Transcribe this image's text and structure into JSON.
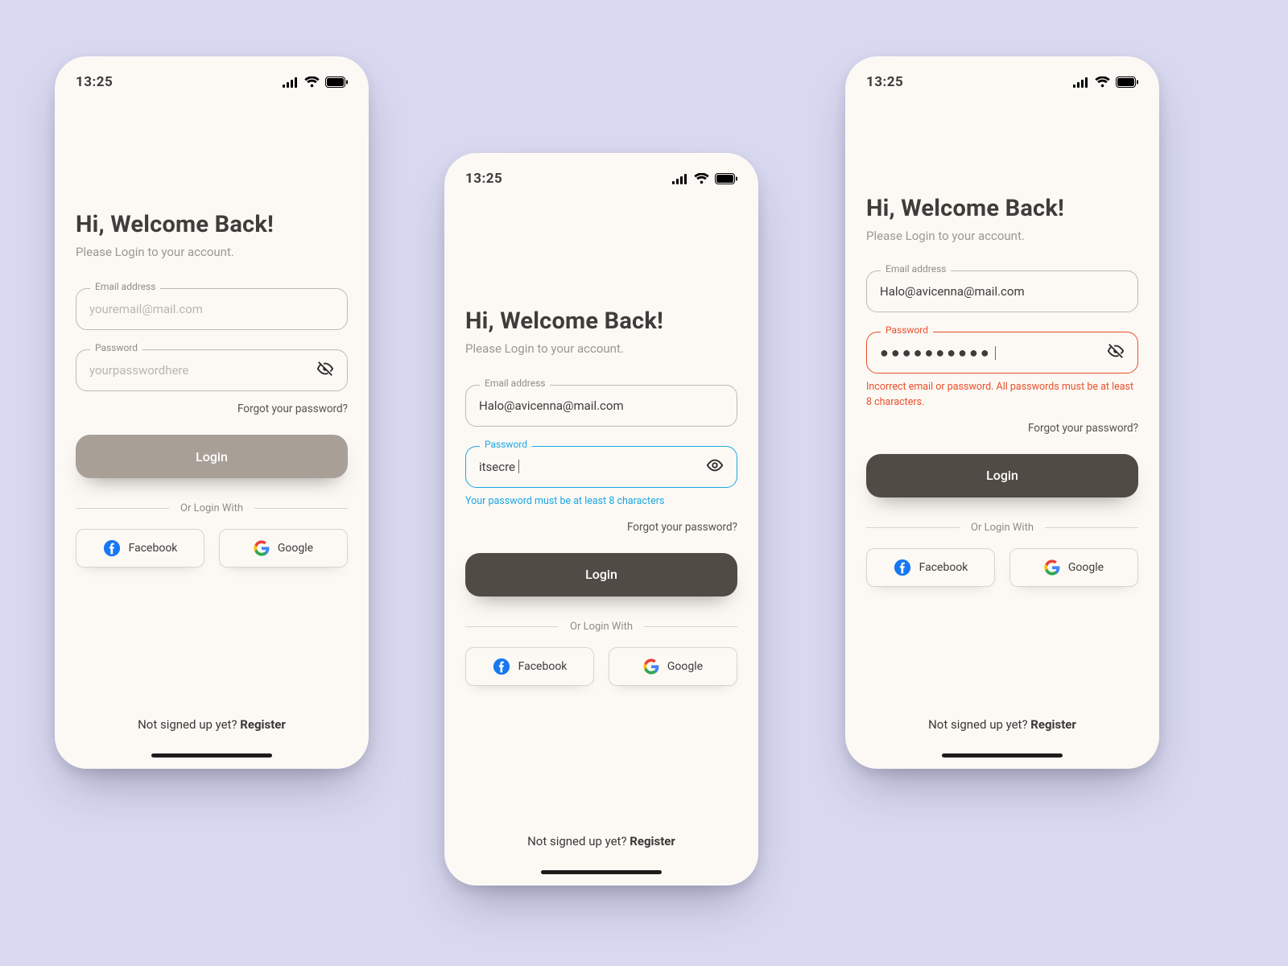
{
  "status_time": "13:25",
  "heading": "Hi, Welcome Back!",
  "subheading": "Please Login to your account.",
  "email_label": "Email address",
  "password_label": "Password",
  "forgot": "Forgot your password?",
  "login": "Login",
  "divider": "Or Login With",
  "facebook": "Facebook",
  "google": "Google",
  "signup_prefix": "Not signed up yet? ",
  "signup_link": "Register",
  "a": {
    "email_placeholder": "youremail@mail.com",
    "password_placeholder": "yourpasswordhere"
  },
  "b": {
    "email_value": "Halo@avicenna@mail.com",
    "password_value": "itsecre",
    "password_hint": "Your password must be at least 8 characters"
  },
  "c": {
    "email_value": "Halo@avicenna@mail.com",
    "password_mask": "●●●●●●●●●●",
    "error_msg": "Incorrect email or password. All passwords must be at least 8 characters."
  }
}
